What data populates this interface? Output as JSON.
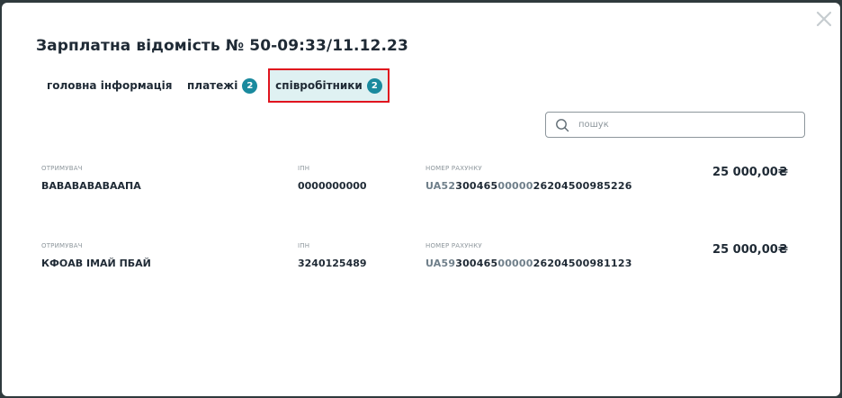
{
  "modal": {
    "title": "Зарплатна відомість № 50-09:33/11.12.23",
    "close_icon": "close-icon"
  },
  "tabs": [
    {
      "label": "головна інформація",
      "badge": null,
      "active": false
    },
    {
      "label": "платежі",
      "badge": "2",
      "active": false
    },
    {
      "label": "співробітники",
      "badge": "2",
      "active": true
    }
  ],
  "search": {
    "placeholder": "пошук",
    "value": "",
    "icon": "search-icon"
  },
  "labels": {
    "recipient": "ОТРИМУВАЧ",
    "ipn": "ІПН",
    "account": "НОМЕР РАХУНКУ"
  },
  "employees": [
    {
      "recipient": "ВАВАВАВАВААПА",
      "ipn": "0000000000",
      "account": {
        "part1": "UA52",
        "part2": "300465",
        "part3": "00000",
        "part4": "26204500985226"
      },
      "amount": "25 000,00₴"
    },
    {
      "recipient": "КФОАВ ІМАЙ ПБАЙ",
      "ipn": "3240125489",
      "account": {
        "part1": "UA59",
        "part2": "300465",
        "part3": "00000",
        "part4": "26204500981123"
      },
      "amount": "25 000,00₴"
    }
  ],
  "colors": {
    "accent": "#1a8a9e",
    "highlight_border": "#e0141e",
    "active_tab_bg": "#dff1f2",
    "text": "#1f2a35",
    "muted": "#8d969c"
  }
}
